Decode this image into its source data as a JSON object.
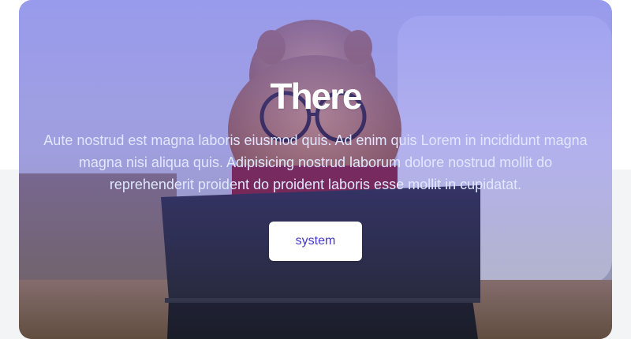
{
  "hero": {
    "title": "There",
    "description": "Aute nostrud est magna laboris eiusmod quis. Ad enim quis Lorem in incididunt magna magna nisi aliqua quis. Adipisicing nostrud laborum dolore nostrud mollit do reprehenderit proident do proident laboris esse mollit in cupidatat.",
    "button_label": "system",
    "background_image": "pomeranian-with-glasses-tablet-photo"
  },
  "colors": {
    "overlay": "#6366f1",
    "button_text": "#4338ca",
    "description_text": "#e0e7ff",
    "page_bottom": "#f3f4f6"
  }
}
